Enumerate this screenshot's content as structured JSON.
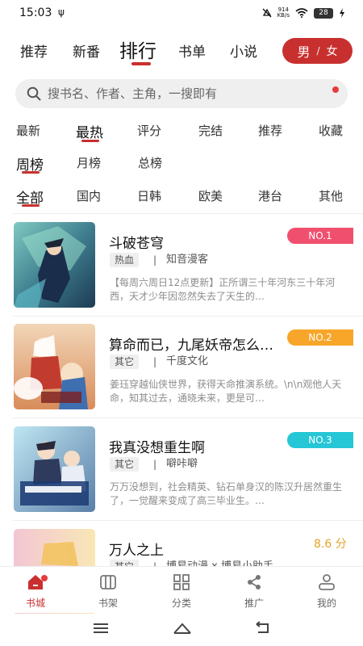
{
  "status": {
    "time": "15:03",
    "usb_icon": "ψ",
    "net_speed_value": "914",
    "net_speed_unit": "KB/s",
    "battery": "28"
  },
  "top_tabs": [
    "推荐",
    "新番",
    "排行",
    "书单",
    "小说"
  ],
  "active_top_tab": "排行",
  "gender": {
    "male": "男",
    "separator": "/",
    "female": "女"
  },
  "search": {
    "placeholder": "搜书名、作者、主角，一搜即有"
  },
  "filters": {
    "sort": [
      "最新",
      "最热",
      "评分",
      "完结",
      "推荐",
      "收藏"
    ],
    "period": [
      "周榜",
      "月榜",
      "总榜"
    ],
    "region": [
      "全部",
      "国内",
      "日韩",
      "欧美",
      "港台",
      "其他"
    ],
    "active": {
      "sort": "最热",
      "period": "周榜",
      "region": "全部"
    }
  },
  "books": [
    {
      "title": "斗破苍穹",
      "tag": "热血",
      "separator": "|",
      "author": "知音漫客",
      "desc": "【每周六周日12点更新】正所谓三十年河东三十年河西，天才少年因忽然失去了天生的…",
      "rank": "NO.1",
      "rank_color": "#f0506e"
    },
    {
      "title": "算命而已，九尾妖帝怎么…",
      "tag": "其它",
      "separator": "|",
      "author": "千度文化",
      "desc": "姜珏穿越仙侠世界，获得天命推演系统。\\n\\n观他人天命，知其过去，通晓未来，更是可…",
      "rank": "NO.2",
      "rank_color": "#f7a62a"
    },
    {
      "title": "我真没想重生啊",
      "tag": "其它",
      "separator": "|",
      "author": "噼咔噼",
      "desc": "万万没想到，社会精英、钻石单身汉的陈汉升居然重生了，一觉醒来变成了高三毕业生。…",
      "rank": "NO.3",
      "rank_color": "#25c6d6"
    },
    {
      "title": "万人之上",
      "tag": "其它",
      "separator": "|",
      "author": "博易动漫 x 博易小助手",
      "score": "8.6 分"
    }
  ],
  "bottom_nav": [
    {
      "label": "书城",
      "icon": "home-icon"
    },
    {
      "label": "书架",
      "icon": "bookshelf-icon"
    },
    {
      "label": "分类",
      "icon": "category-icon"
    },
    {
      "label": "推广",
      "icon": "share-icon"
    },
    {
      "label": "我的",
      "icon": "profile-icon"
    }
  ],
  "colors": {
    "accent": "#c8302f",
    "badge_dot": "#e53c3c",
    "score": "#e4a227"
  }
}
